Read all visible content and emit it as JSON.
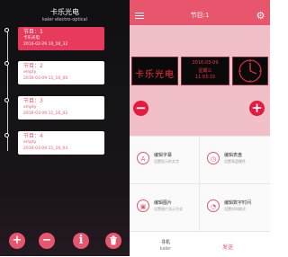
{
  "left_panel": {
    "title": "卡乐光电",
    "subtitle": "kaler electro-optical",
    "items": [
      {
        "title": "节目：1",
        "subtitle": "卡乐光电",
        "date": "2016-02-29 10_18_32"
      },
      {
        "title": "节目：2",
        "subtitle": "empty",
        "date": "2016-03-09 11_16_00"
      },
      {
        "title": "节目：3",
        "subtitle": "empty",
        "date": "2016-03-09 11_16_02"
      },
      {
        "title": "节目：4",
        "subtitle": "empty",
        "date": "2016-03-09 11_16_03"
      }
    ],
    "buttons": {
      "add": "+",
      "remove": "−",
      "info": "i"
    }
  },
  "right_panel": {
    "header_title": "节目:1",
    "preview": {
      "led_text": "卡乐光电",
      "clock_lines": [
        "2016-03-09",
        "星期三",
        "11:03:15"
      ]
    },
    "actions": [
      {
        "icon_glyph": "A",
        "title": "编辑字幕",
        "subtitle": "设置显示的文字"
      },
      {
        "icon_glyph": "◷",
        "title": "编辑表盘",
        "subtitle": "设置表盘属性"
      },
      {
        "icon_glyph": "▣",
        "title": "编辑图片",
        "subtitle": "设置图片显示方式"
      },
      {
        "icon_glyph": "◔",
        "title": "编辑数字时间",
        "subtitle": "设置时间格式"
      }
    ],
    "footer": {
      "device_label": "寻机",
      "device_name": "kaler",
      "send_label": "发送"
    }
  },
  "colors": {
    "accent": "#e8566e",
    "selected": "#e83a5c",
    "preview_bg": "#f0bfc7"
  }
}
